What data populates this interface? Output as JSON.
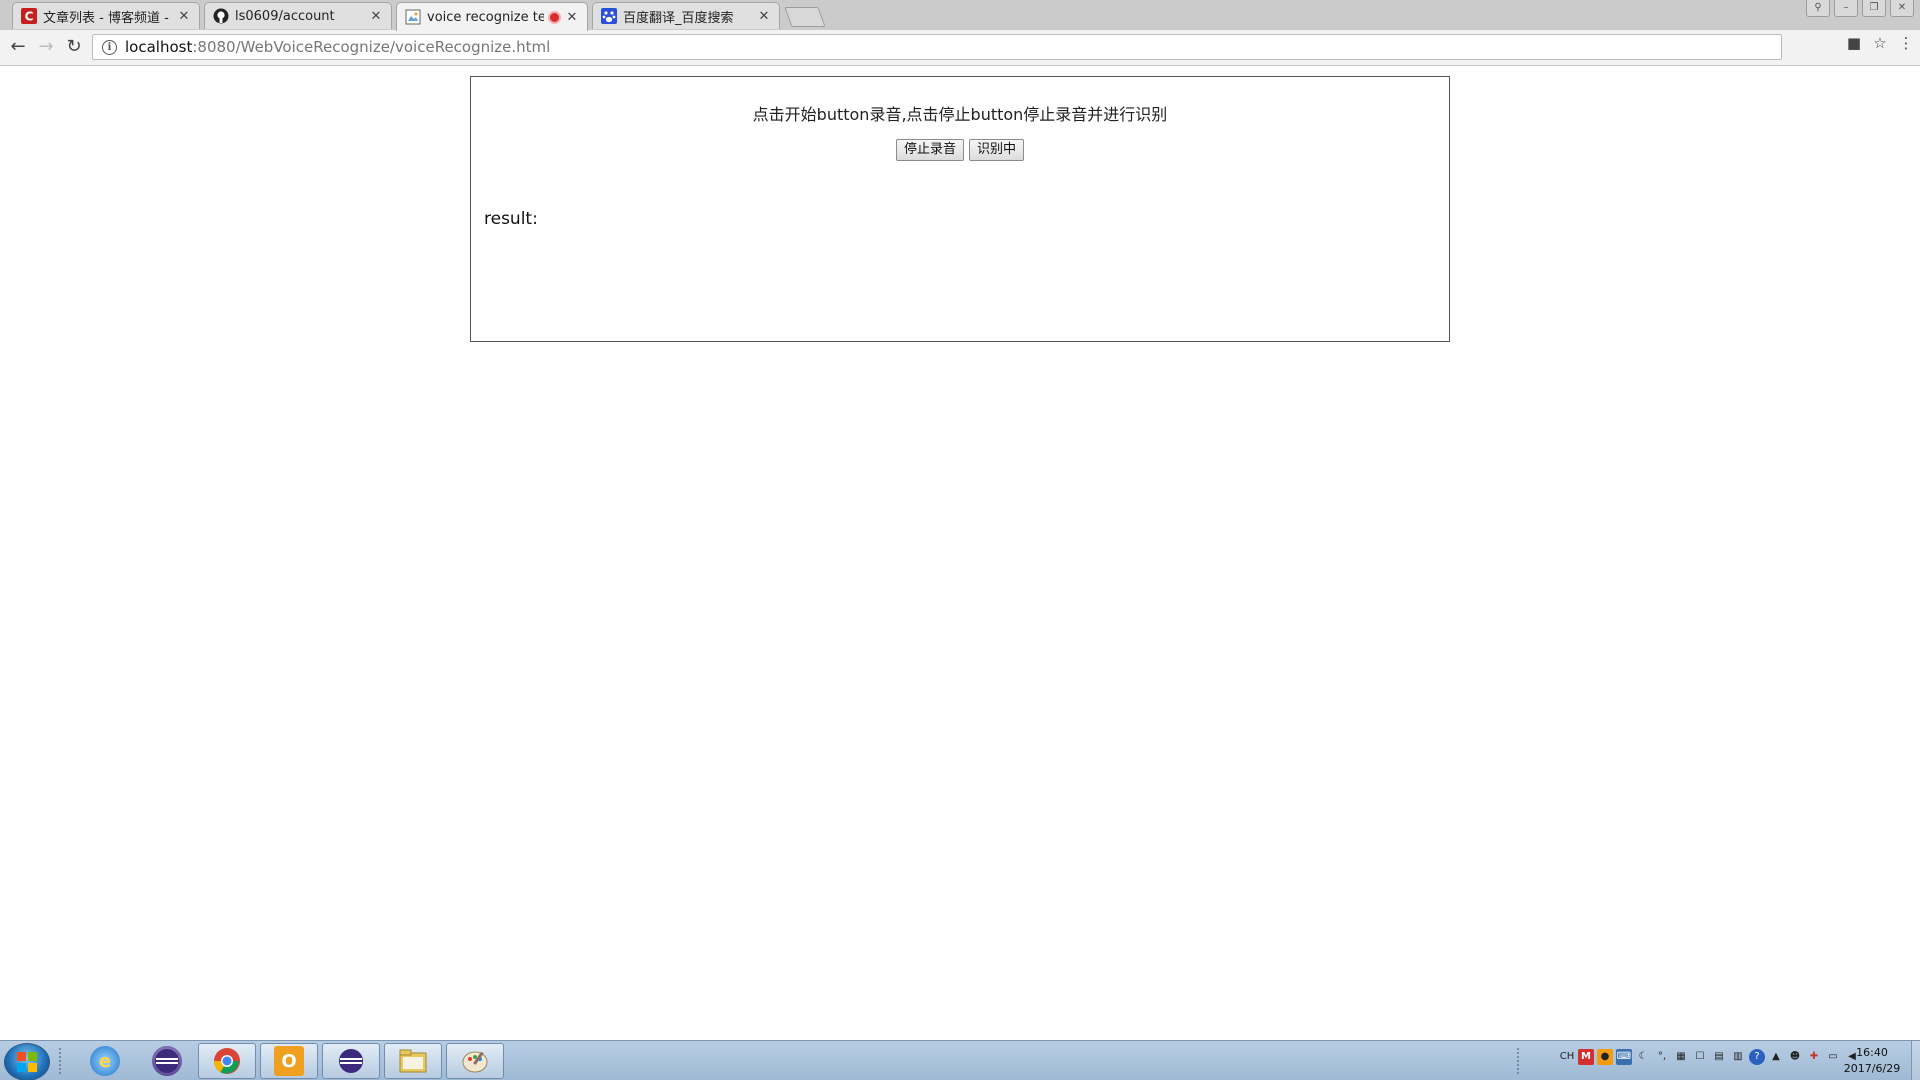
{
  "browser": {
    "tabs": [
      {
        "title": "文章列表 - 博客频道 - C",
        "favicon": "csdn-icon",
        "active": false
      },
      {
        "title": "ls0609/account",
        "favicon": "github-icon",
        "active": false
      },
      {
        "title": "voice recognize test",
        "favicon": "page-icon",
        "active": true,
        "recording": true
      },
      {
        "title": "百度翻译_百度搜索",
        "favicon": "baidu-icon",
        "active": false
      }
    ],
    "address": {
      "host": "localhost",
      "path": ":8080/WebVoiceRecognize/voiceRecognize.html"
    }
  },
  "page": {
    "instruction": "点击开始button录音,点击停止button停止录音并进行识别",
    "stop_button": "停止录音",
    "recognize_button": "识别中",
    "result_label": "result:"
  },
  "taskbar": {
    "apps": [
      {
        "name": "internet-explorer-icon",
        "open": false
      },
      {
        "name": "eclipse-icon",
        "open": false
      },
      {
        "name": "chrome-icon",
        "open": true
      },
      {
        "name": "outlook-icon",
        "open": true
      },
      {
        "name": "eclipse-icon",
        "open": true
      },
      {
        "name": "file-explorer-icon",
        "open": true
      },
      {
        "name": "paint-icon",
        "open": true
      }
    ],
    "tray_language": "CH",
    "clock_time": "16:40",
    "clock_date": "2017/6/29"
  },
  "colors": {
    "tab_active": "#f2f2f2",
    "tab_inactive": "#e0e0e0",
    "taskbar": "#aec4dc",
    "recording": "#d32f2f"
  }
}
